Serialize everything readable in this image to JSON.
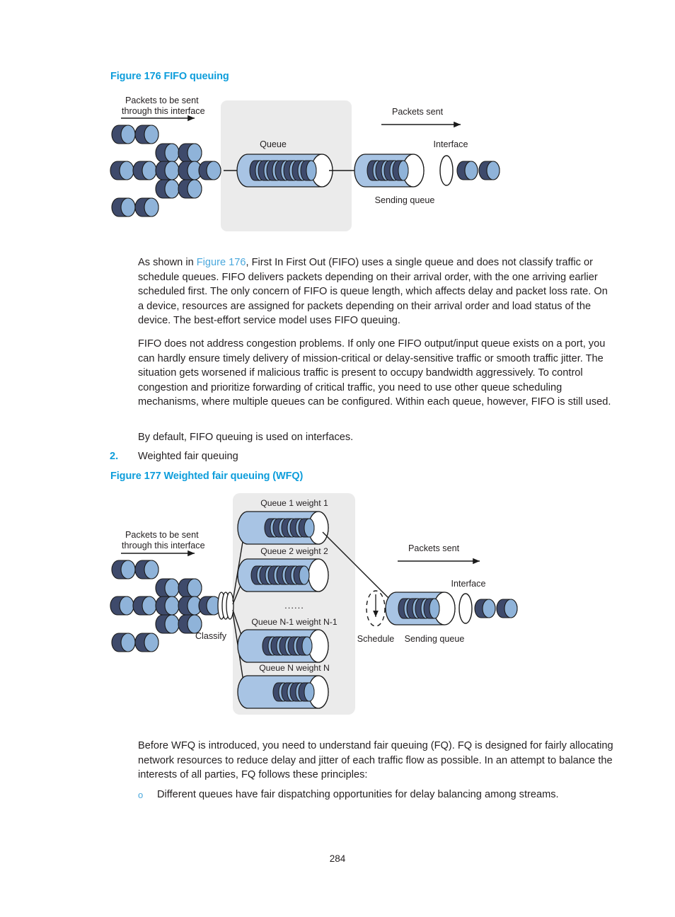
{
  "document": {
    "page_number": "284"
  },
  "figures": {
    "fifo": {
      "heading": "Figure 176 FIFO queuing",
      "labels": {
        "packets_in_line1": "Packets to be sent",
        "packets_in_line2": "through this interface",
        "packets_sent": "Packets sent",
        "queue": "Queue",
        "interface": "Interface",
        "sending_queue": "Sending queue"
      },
      "queue_packet_count": 7,
      "sending_queue_packet_count": 4,
      "outgoing_packet_count": 2,
      "incoming_cluster_rows": [
        2,
        2,
        5,
        2,
        2
      ]
    },
    "wfq": {
      "heading": "Figure 177 Weighted fair queuing (WFQ)",
      "labels": {
        "packets_in_line1": "Packets to be sent",
        "packets_in_line2": "through this interface",
        "packets_sent": "Packets sent",
        "classify": "Classify",
        "schedule": "Schedule",
        "interface": "Interface",
        "sending_queue": "Sending queue",
        "ellipsis": "......"
      },
      "queues": [
        {
          "label": "Queue 1  weight 1",
          "packets": 5
        },
        {
          "label": "Queue 2  weight 2",
          "packets": 6
        },
        {
          "label": "Queue N-1  weight N-1",
          "packets": 5
        },
        {
          "label": "Queue N  weight N",
          "packets": 4
        }
      ],
      "sending_queue_packet_count": 4,
      "outgoing_packet_count": 2,
      "incoming_cluster_rows": [
        2,
        2,
        5,
        2,
        2
      ]
    }
  },
  "content": {
    "para_fifo_1_pre": "As shown in ",
    "para_fifo_1_link": "Figure 176",
    "para_fifo_1_post": ", First In First Out (FIFO) uses a single queue and does not classify traffic or schedule queues. FIFO delivers packets depending on their arrival order, with the one arriving earlier scheduled first. The only concern of FIFO is queue length, which affects delay and packet loss rate. On a device, resources are assigned for packets depending on their arrival order and load status of the device. The best-effort service model uses FIFO queuing.",
    "para_fifo_2": "FIFO does not address congestion problems. If only one FIFO output/input queue exists on a port, you can hardly ensure timely delivery of mission-critical or delay-sensitive traffic or smooth traffic jitter. The situation gets worsened if malicious traffic is present to occupy bandwidth aggressively. To control congestion and prioritize forwarding of critical traffic, you need to use other queue scheduling mechanisms, where multiple queues can be configured. Within each queue, however, FIFO is still used.",
    "para_fifo_3": "By default, FIFO queuing is used on interfaces.",
    "list_item_2_number": "2.",
    "list_item_2_text": "Weighted fair queuing",
    "para_wfq_1": "Before WFQ is introduced, you need to understand fair queuing (FQ). FQ is designed for fairly allocating network resources to reduce delay and jitter of each traffic flow as possible. In an attempt to balance the interests of all parties, FQ follows these principles:",
    "bullet_mark": "o",
    "bullet_1": "Different queues have fair dispatching opportunities for delay balancing among streams."
  },
  "colors": {
    "heading_blue": "#0d9ddb",
    "link_blue": "#4aa8dd",
    "packet_body": "#3e4a6b",
    "packet_face": "#8fb3d9",
    "cylinder_body": "#a8c4e4",
    "cylinder_face": "#ffffff",
    "panel_gray": "#ebebeb",
    "outline": "#1a1a1a",
    "text": "#231f20"
  }
}
